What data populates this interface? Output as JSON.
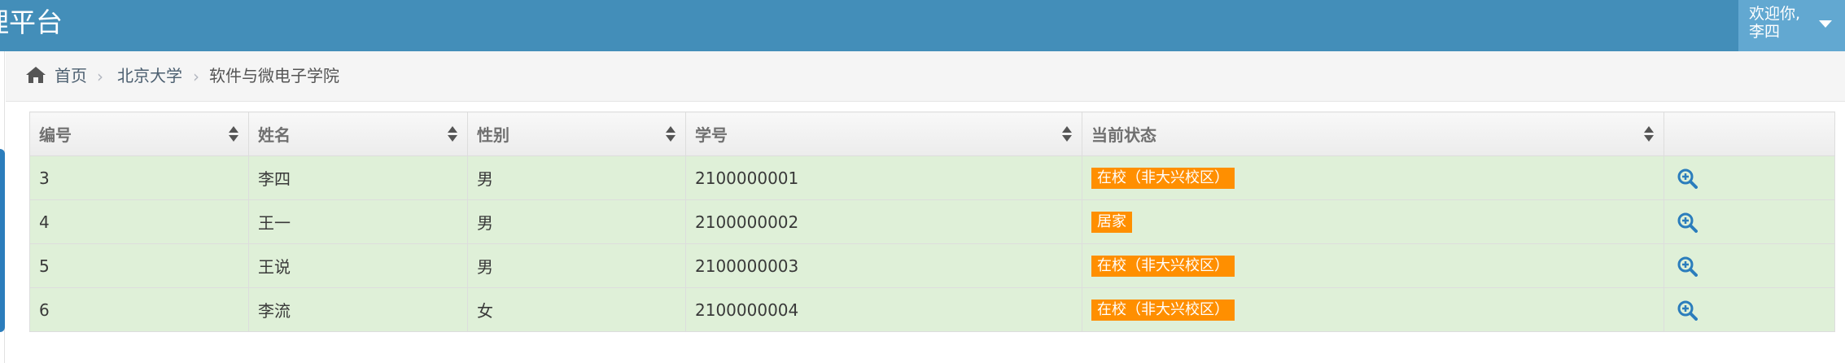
{
  "navbar": {
    "brand": "理平台",
    "user_greeting": "欢迎你,",
    "user_name": "李四",
    "colors": {
      "bar": "#438eb9",
      "user_menu": "#62a8d1"
    }
  },
  "breadcrumbs": {
    "home_icon": "home-icon",
    "items": [
      "首页",
      "北京大学",
      "软件与微电子学院"
    ],
    "separator": "›"
  },
  "table": {
    "columns": [
      "编号",
      "姓名",
      "性别",
      "学号",
      "当前状态",
      ""
    ],
    "sortable_icon": "sort-icon",
    "row_icon": "zoom-in-icon",
    "rows": [
      {
        "id": "3",
        "name": "李四",
        "gender": "男",
        "student_no": "2100000001",
        "status": "在校（非大兴校区）"
      },
      {
        "id": "4",
        "name": "王一",
        "gender": "男",
        "student_no": "2100000002",
        "status": "居家"
      },
      {
        "id": "5",
        "name": "王说",
        "gender": "男",
        "student_no": "2100000003",
        "status": "在校（非大兴校区）"
      },
      {
        "id": "6",
        "name": "李流",
        "gender": "女",
        "student_no": "2100000004",
        "status": "在校（非大兴校区）"
      }
    ],
    "colors": {
      "row_bg": "#dff0d8",
      "status_label": "#ff8f00",
      "icon": "#2b7dbc"
    }
  }
}
